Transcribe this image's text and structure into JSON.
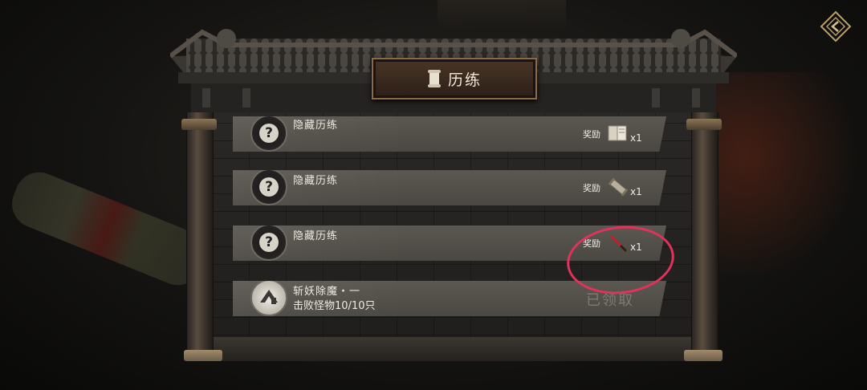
{
  "title": "历练",
  "tasks": [
    {
      "name": "隐藏历练",
      "reward_label": "奖励",
      "reward_count": "x1",
      "reward_icon": "book-icon"
    },
    {
      "name": "隐藏历练",
      "reward_label": "奖励",
      "reward_count": "x1",
      "reward_icon": "scroll-icon"
    },
    {
      "name": "隐藏历练",
      "reward_label": "奖励",
      "reward_count": "x1",
      "reward_icon": "red-brush-icon"
    },
    {
      "name": "斩妖除魔・一",
      "subtitle": "击败怪物10/10只",
      "status": "已领取",
      "avatar_icon": "emblem-icon"
    }
  ],
  "colors": {
    "highlight": "#e0325a",
    "card": "#55524c",
    "plaque": "#3a2a1f"
  }
}
